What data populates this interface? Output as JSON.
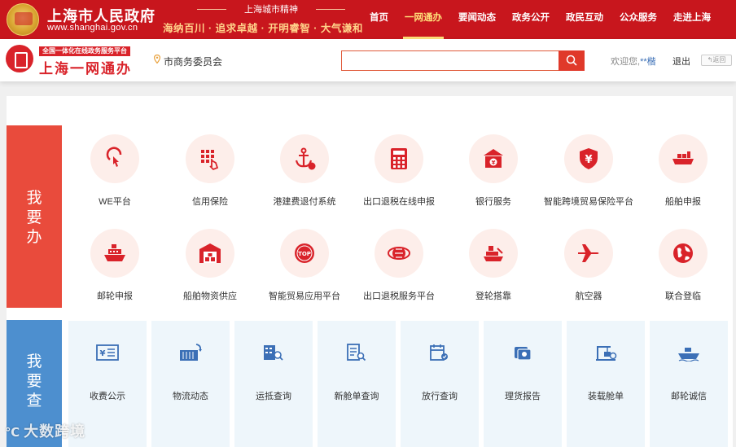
{
  "header": {
    "gov_title": "上海市人民政府",
    "gov_url": "www.shanghai.gov.cn",
    "spirit_title": "上海城市精神",
    "spirit_text": "海纳百川 · 追求卓越 · 开明睿智 · 大气谦和",
    "nav": [
      {
        "label": "首页",
        "active": false
      },
      {
        "label": "一网通办",
        "active": true
      },
      {
        "label": "要闻动态",
        "active": false
      },
      {
        "label": "政务公开",
        "active": false
      },
      {
        "label": "政民互动",
        "active": false
      },
      {
        "label": "公众服务",
        "active": false
      },
      {
        "label": "走进上海",
        "active": false
      }
    ]
  },
  "subheader": {
    "platform_badge": "全国一体化在线政务服务平台",
    "platform_title": "上海一网通办",
    "location": "市商务委员会",
    "search_value": "",
    "welcome": "欢迎您,",
    "user": "**楷",
    "logout": "退出",
    "back": "返回"
  },
  "sections": {
    "do_label": "我要办",
    "check_label": "我要查"
  },
  "do_services": [
    {
      "name": "WE平台",
      "icon": "touch-icon"
    },
    {
      "name": "信用保险",
      "icon": "keypad-hand-icon"
    },
    {
      "name": "港建费退付系统",
      "icon": "anchor-yen-icon"
    },
    {
      "name": "出口退税在线申报",
      "icon": "calculator-icon"
    },
    {
      "name": "银行服务",
      "icon": "bank-icon"
    },
    {
      "name": "智能跨境贸易保险平台",
      "icon": "shield-yen-icon"
    },
    {
      "name": "船舶申报",
      "icon": "cargo-ship-icon"
    },
    {
      "name": "邮轮申报",
      "icon": "cruise-ship-icon"
    },
    {
      "name": "船舶物资供应",
      "icon": "warehouse-icon"
    },
    {
      "name": "智能贸易应用平台",
      "icon": "top-badge-icon"
    },
    {
      "name": "出口退税服务平台",
      "icon": "globe-ring-icon"
    },
    {
      "name": "登轮搭靠",
      "icon": "boarding-icon"
    },
    {
      "name": "航空器",
      "icon": "airplane-icon"
    },
    {
      "name": "联合登临",
      "icon": "globe-icon"
    }
  ],
  "check_services": [
    {
      "name": "收费公示",
      "icon": "yen-receipt-icon"
    },
    {
      "name": "物流动态",
      "icon": "container-icon"
    },
    {
      "name": "运抵查询",
      "icon": "building-search-icon"
    },
    {
      "name": "新舱单查询",
      "icon": "document-search-icon"
    },
    {
      "name": "放行查询",
      "icon": "calendar-check-icon"
    },
    {
      "name": "理货报告",
      "icon": "stack-icon"
    },
    {
      "name": "装载舱单",
      "icon": "crane-icon"
    },
    {
      "name": "邮轮诚信",
      "icon": "ship-icon"
    }
  ],
  "colors": {
    "brand_red": "#c8161d",
    "do_section": "#e94b3c",
    "check_section": "#4d8fcf",
    "icon_red": "#d9232a",
    "icon_blue": "#3b6fb6"
  },
  "watermark": "大数跨境"
}
